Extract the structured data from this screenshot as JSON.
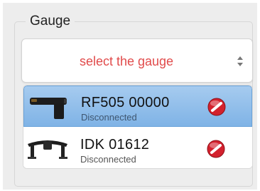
{
  "gauge_panel": {
    "legend": "Gauge",
    "select": {
      "value": "select the gauge",
      "value_color": "#e14b4b"
    },
    "devices": [
      {
        "name": "RF505 00000",
        "status": "Disconnected",
        "selected": true,
        "icon": "rf505-gauge-icon",
        "action_icon": "no-entry-icon"
      },
      {
        "name": "IDK 01612",
        "status": "Disconnected",
        "selected": false,
        "icon": "idk-gauge-icon",
        "action_icon": "no-entry-icon"
      }
    ]
  },
  "colors": {
    "selection": "#8dbcea",
    "status_red": "#d3212d"
  }
}
